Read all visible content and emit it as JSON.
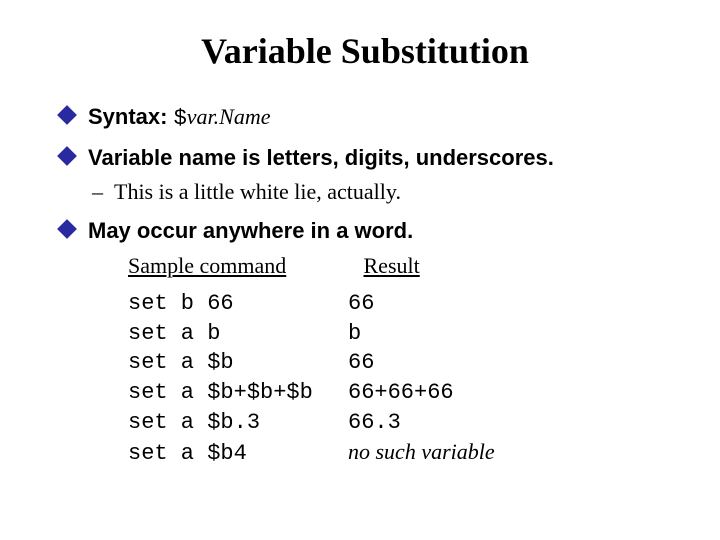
{
  "title": "Variable Substitution",
  "bullets": {
    "b1_label": "Syntax: ",
    "b1_code_dollar": "$",
    "b1_varname": "var.Name",
    "b2": "Variable name is letters, digits, underscores.",
    "b2_sub": "This is a little white lie, actually.",
    "b3": "May occur anywhere in a word."
  },
  "headers": {
    "cmd": "Sample command",
    "res": "Result"
  },
  "rows": [
    {
      "cmd": "set b 66",
      "res": "66"
    },
    {
      "cmd": "set a b",
      "res": "b"
    },
    {
      "cmd": "set a $b",
      "res": "66"
    },
    {
      "cmd": "set a $b+$b+$b",
      "res": "66+66+66"
    },
    {
      "cmd": "set a $b.3",
      "res": "66.3"
    },
    {
      "cmd": "set a $b4",
      "res": "no such variable",
      "italic": true
    }
  ]
}
